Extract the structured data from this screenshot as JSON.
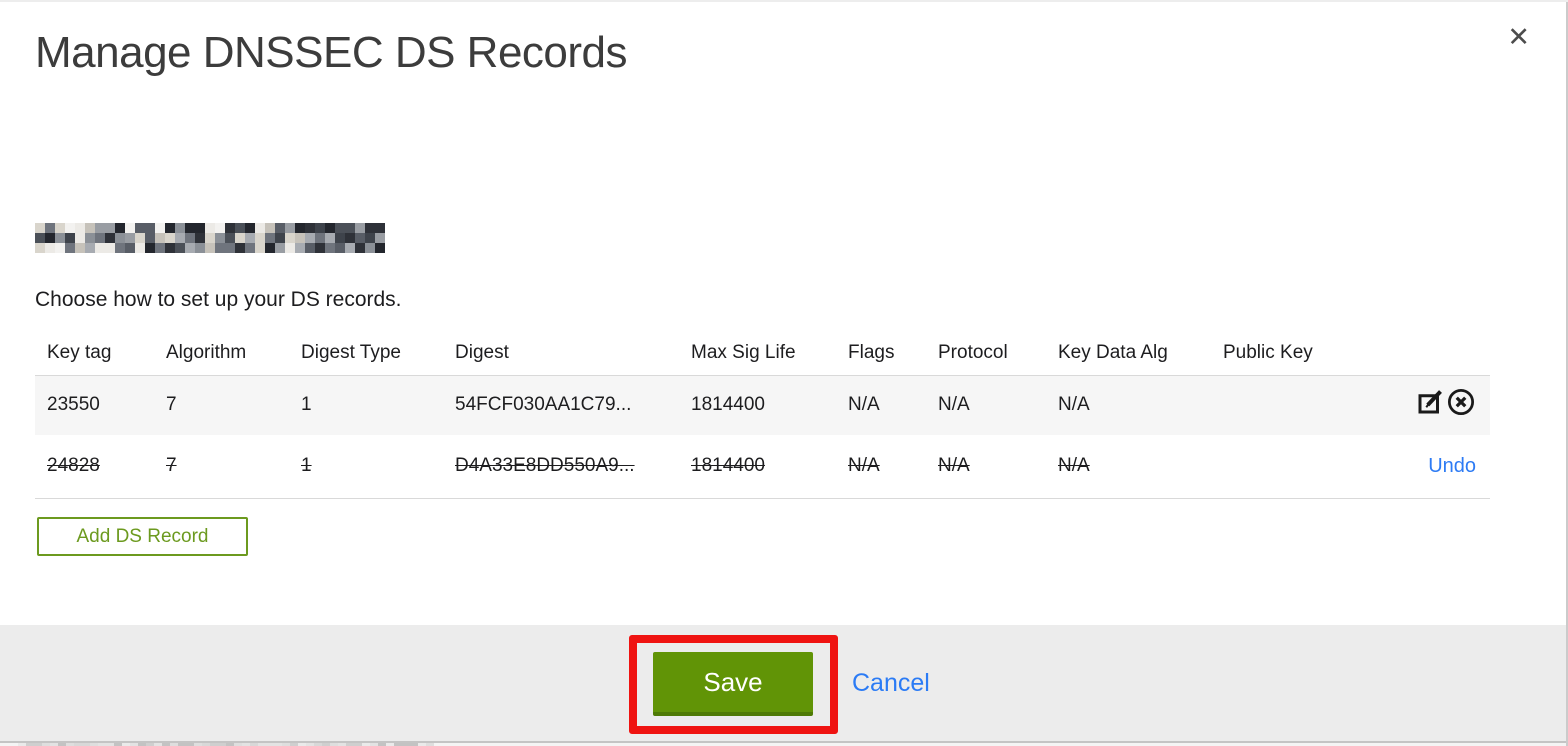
{
  "dialog": {
    "title": "Manage DNSSEC DS Records",
    "subtitle": "Choose how to set up your DS records.",
    "close_icon": "✕",
    "domain_redacted": true
  },
  "table": {
    "columns": [
      "Key tag",
      "Algorithm",
      "Digest Type",
      "Digest",
      "Max Sig Life",
      "Flags",
      "Protocol",
      "Key Data Alg",
      "Public Key"
    ],
    "rows": [
      {
        "key_tag": "23550",
        "algorithm": "7",
        "digest_type": "1",
        "digest": "54FCF030AA1C79...",
        "max_sig_life": "1814400",
        "flags": "N/A",
        "protocol": "N/A",
        "key_data_alg": "N/A",
        "public_key": "",
        "state": "normal",
        "actions": [
          "edit-icon",
          "delete-icon"
        ]
      },
      {
        "key_tag": "24828",
        "algorithm": "7",
        "digest_type": "1",
        "digest": "D4A33E8DD550A9...",
        "max_sig_life": "1814400",
        "flags": "N/A",
        "protocol": "N/A",
        "key_data_alg": "N/A",
        "public_key": "",
        "state": "deleted",
        "undo_label": "Undo"
      }
    ]
  },
  "buttons": {
    "add_ds_record": "Add DS Record",
    "save": "Save",
    "cancel": "Cancel"
  },
  "annotation": {
    "type": "highlight-rectangle",
    "target": "save-button",
    "color": "#ef1311"
  },
  "colors": {
    "add_button_green": "#6c9a1f",
    "save_button_green": "#619406",
    "link_blue": "#2d7bf4",
    "annotation_red": "#ef1311",
    "footer_bg": "#ececec",
    "active_row_bg": "#f6f6f6",
    "title_gray": "#3c3c3c"
  }
}
